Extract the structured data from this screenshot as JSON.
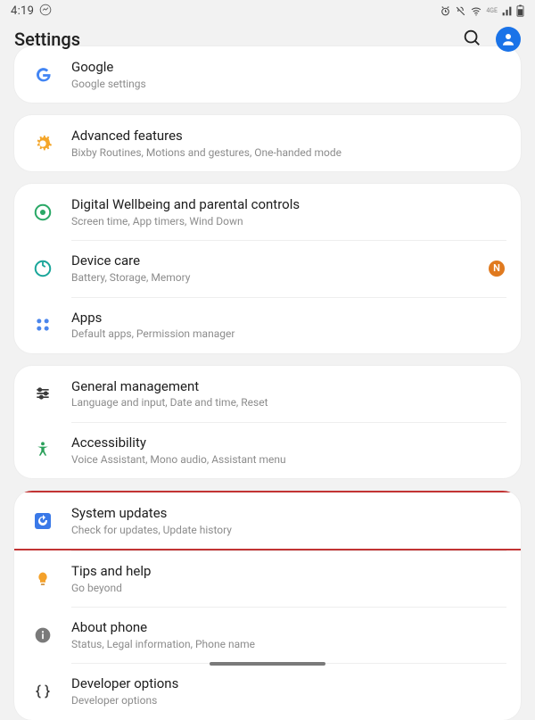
{
  "status_bar": {
    "time": "4:19",
    "indicator_4ge": "4GE"
  },
  "header": {
    "title": "Settings"
  },
  "groups": [
    {
      "id": "google",
      "rows": [
        {
          "id": "google",
          "title": "Google",
          "sub": "Google settings"
        }
      ]
    },
    {
      "id": "advanced",
      "rows": [
        {
          "id": "advanced_features",
          "title": "Advanced features",
          "sub": "Bixby Routines, Motions and gestures, One-handed mode"
        }
      ]
    },
    {
      "id": "wellbeing",
      "rows": [
        {
          "id": "digital_wellbeing",
          "title": "Digital Wellbeing and parental controls",
          "sub": "Screen time, App timers, Wind Down"
        },
        {
          "id": "device_care",
          "title": "Device care",
          "sub": "Battery, Storage, Memory",
          "badge": "N"
        },
        {
          "id": "apps",
          "title": "Apps",
          "sub": "Default apps, Permission manager"
        }
      ]
    },
    {
      "id": "management",
      "rows": [
        {
          "id": "general_management",
          "title": "General management",
          "sub": "Language and input, Date and time, Reset"
        },
        {
          "id": "accessibility",
          "title": "Accessibility",
          "sub": "Voice Assistant, Mono audio, Assistant menu"
        }
      ]
    },
    {
      "id": "system",
      "rows": [
        {
          "id": "system_updates",
          "title": "System updates",
          "sub": "Check for updates, Update history",
          "highlighted": true
        },
        {
          "id": "tips_help",
          "title": "Tips and help",
          "sub": "Go beyond"
        },
        {
          "id": "about_phone",
          "title": "About phone",
          "sub": "Status, Legal information, Phone name"
        },
        {
          "id": "developer_options",
          "title": "Developer options",
          "sub": "Developer options"
        }
      ]
    }
  ]
}
